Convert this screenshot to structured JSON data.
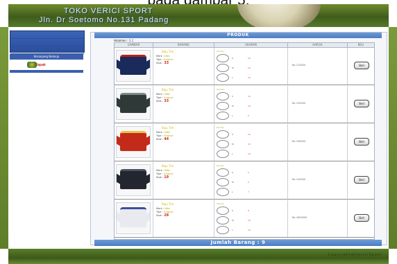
{
  "caption": "pada gambar 5.",
  "header": {
    "title": "TOKO VERICI SPORT",
    "address": "Jln. Dr Soetomo No.131 Padang"
  },
  "sidebar": {
    "menu_items": [
      "",
      "",
      "",
      ""
    ],
    "cart_link": "Keranjang Belanja",
    "logo_text": "lapak"
  },
  "main": {
    "title": "PRODUK",
    "halaman_label": "Halaman : 1",
    "halaman_next": "2",
    "columns": [
      "GAMBAR",
      "BARANG",
      "UKURAN",
      "HARGA",
      "BELI"
    ],
    "footer": "Jumlah Barang : 9"
  },
  "colors": {
    "header_green": "#3f5c1c",
    "title_blue": "#4a7cc4",
    "stock_red": "#cc2a1a",
    "name_yellow": "#d4b810"
  },
  "products": [
    {
      "name": "Baju Tim",
      "merk_label": "Merk :",
      "merk": "Nike",
      "type_label": "Tipe :",
      "type": "Original",
      "stok_label": "Stok :",
      "stok": "33",
      "size_head": "Ukuran",
      "sizes": [
        {
          "label": "S",
          "qty": "10"
        },
        {
          "label": "M",
          "qty": "10"
        },
        {
          "label": "L",
          "qty": "10"
        }
      ],
      "price": "Rp 110000",
      "beli": "Beli",
      "shirt_color": "#1a2a5a",
      "trim_color": "#b8231c"
    },
    {
      "name": "Baju Tim",
      "merk_label": "Merk :",
      "merk": "Nike",
      "type_label": "Tipe :",
      "type": "Original",
      "stok_label": "Stok :",
      "stok": "33",
      "size_head": "Ukuran",
      "sizes": [
        {
          "label": "S",
          "qty": "10"
        },
        {
          "label": "M",
          "qty": "10"
        },
        {
          "label": "L",
          "qty": "5"
        }
      ],
      "price": "Rp 150000",
      "beli": "Beli",
      "shirt_color": "#2f3a38",
      "trim_color": "#7d8a86"
    },
    {
      "name": "Baju Tim",
      "merk_label": "Merk :",
      "merk": "Nike",
      "type_label": "Tipe :",
      "type": "Original",
      "stok_label": "Stok :",
      "stok": "44",
      "size_head": "Ukuran",
      "sizes": [
        {
          "label": "S",
          "qty": "15"
        },
        {
          "label": "M",
          "qty": "15"
        },
        {
          "label": "L",
          "qty": "10"
        }
      ],
      "price": "Rp 158000",
      "beli": "Beli",
      "shirt_color": "#c42a1a",
      "trim_color": "#e7c24a"
    },
    {
      "name": "Baju Tim",
      "merk_label": "Merk :",
      "merk": "Nike",
      "type_label": "Tipe :",
      "type": "Original",
      "stok_label": "Stok :",
      "stok": "19",
      "size_head": "Ukuran",
      "sizes": [
        {
          "label": "S",
          "qty": "5"
        },
        {
          "label": "M",
          "qty": "5"
        },
        {
          "label": "L",
          "qty": "7"
        }
      ],
      "price": "Rp 140000",
      "beli": "Beli",
      "shirt_color": "#23262e",
      "trim_color": "#4a5060"
    },
    {
      "name": "Baju Tim",
      "merk_label": "Merk :",
      "merk": "Nike",
      "type_label": "Tipe :",
      "type": "Original",
      "stok_label": "Stok :",
      "stok": "28",
      "size_head": "Ukuran",
      "sizes": [
        {
          "label": "S",
          "qty": "8"
        },
        {
          "label": "M",
          "qty": "10"
        },
        {
          "label": "L",
          "qty": "10"
        }
      ],
      "price": "Rp 1600000",
      "beli": "Beli",
      "shirt_color": "#e8eaf0",
      "trim_color": "#3b4f9a"
    }
  ],
  "footer_band": {
    "copyright": "Copyright@VericiSport"
  }
}
